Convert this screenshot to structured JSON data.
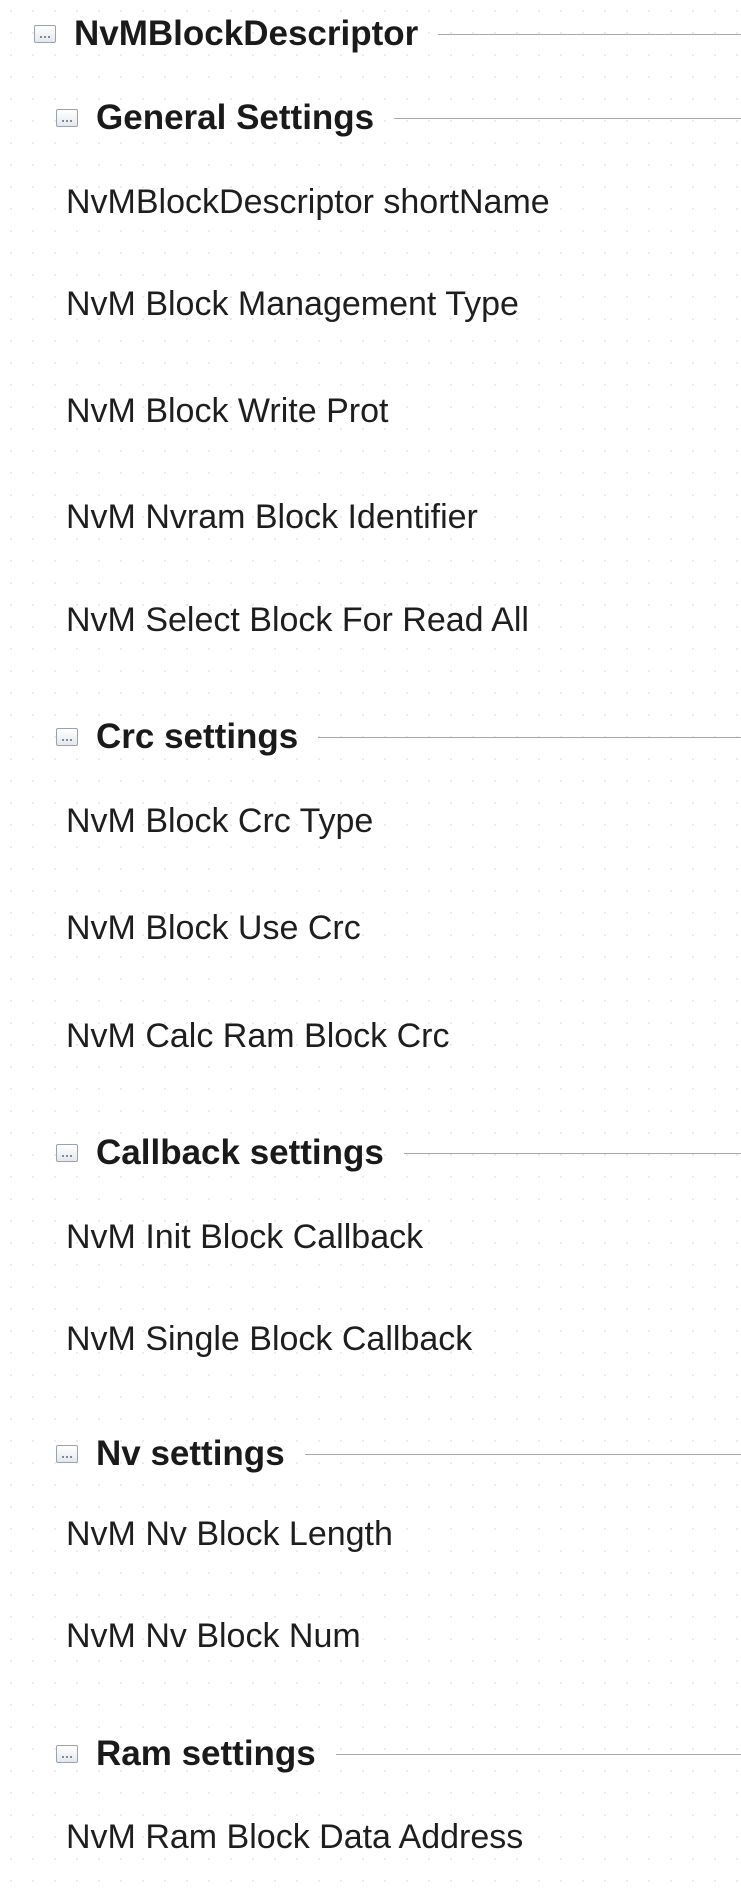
{
  "root": {
    "title": "NvMBlockDescriptor"
  },
  "groups": [
    {
      "title": "General Settings",
      "items": [
        "NvMBlockDescriptor shortName",
        "NvM Block Management Type",
        "NvM Block Write Prot",
        "NvM Nvram Block Identifier",
        "NvM Select Block For Read All"
      ]
    },
    {
      "title": "Crc settings",
      "items": [
        "NvM Block Crc Type",
        "NvM Block Use Crc",
        "NvM Calc Ram Block Crc"
      ]
    },
    {
      "title": "Callback settings",
      "items": [
        "NvM Init Block Callback",
        "NvM Single Block Callback"
      ]
    },
    {
      "title": "Nv settings",
      "items": [
        "NvM Nv Block Length",
        "NvM Nv Block Num"
      ]
    },
    {
      "title": "Ram settings",
      "items": [
        "NvM Ram Block Data Address"
      ]
    }
  ]
}
